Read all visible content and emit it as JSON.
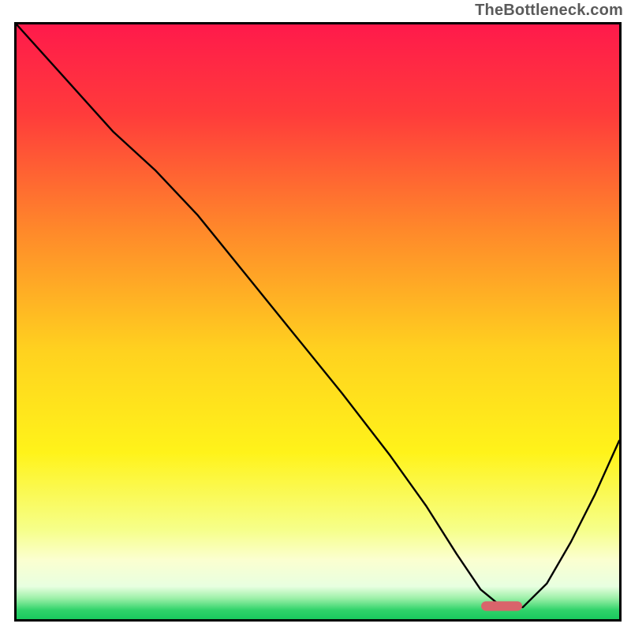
{
  "watermark": "TheBottleneck.com",
  "chart_data": {
    "type": "line",
    "title": "",
    "xlabel": "",
    "ylabel": "",
    "xlim": [
      0,
      100
    ],
    "ylim": [
      0,
      100
    ],
    "grid": false,
    "legend": "none",
    "gradient_stops": [
      {
        "offset": 0.0,
        "color": "#ff1a4b"
      },
      {
        "offset": 0.15,
        "color": "#ff3b3b"
      },
      {
        "offset": 0.35,
        "color": "#ff8a2a"
      },
      {
        "offset": 0.55,
        "color": "#ffd21f"
      },
      {
        "offset": 0.72,
        "color": "#fff31a"
      },
      {
        "offset": 0.85,
        "color": "#f6ff8a"
      },
      {
        "offset": 0.9,
        "color": "#fbffd0"
      },
      {
        "offset": 0.945,
        "color": "#e8ffe0"
      },
      {
        "offset": 0.965,
        "color": "#9cf0a8"
      },
      {
        "offset": 0.985,
        "color": "#2fd36a"
      },
      {
        "offset": 1.0,
        "color": "#19c95e"
      }
    ],
    "series": [
      {
        "name": "bottleneck-curve",
        "stroke": "#000000",
        "stroke_width": 2.4,
        "x": [
          0.0,
          8.0,
          16.0,
          23.0,
          30.0,
          38.0,
          46.0,
          54.0,
          62.0,
          68.0,
          73.0,
          77.0,
          80.0,
          84.0,
          88.0,
          92.0,
          96.0,
          100.0
        ],
        "y": [
          100.0,
          91.0,
          82.0,
          75.5,
          68.0,
          58.0,
          48.0,
          38.0,
          27.5,
          19.0,
          11.0,
          5.0,
          2.5,
          2.0,
          6.0,
          13.0,
          21.0,
          30.0
        ]
      }
    ],
    "marker": {
      "name": "optimal-range-marker",
      "shape": "rounded-rect",
      "fill": "#d9646b",
      "x_center": 80.5,
      "y_center": 2.2,
      "width": 6.8,
      "height": 1.6,
      "rx": 0.8
    }
  }
}
